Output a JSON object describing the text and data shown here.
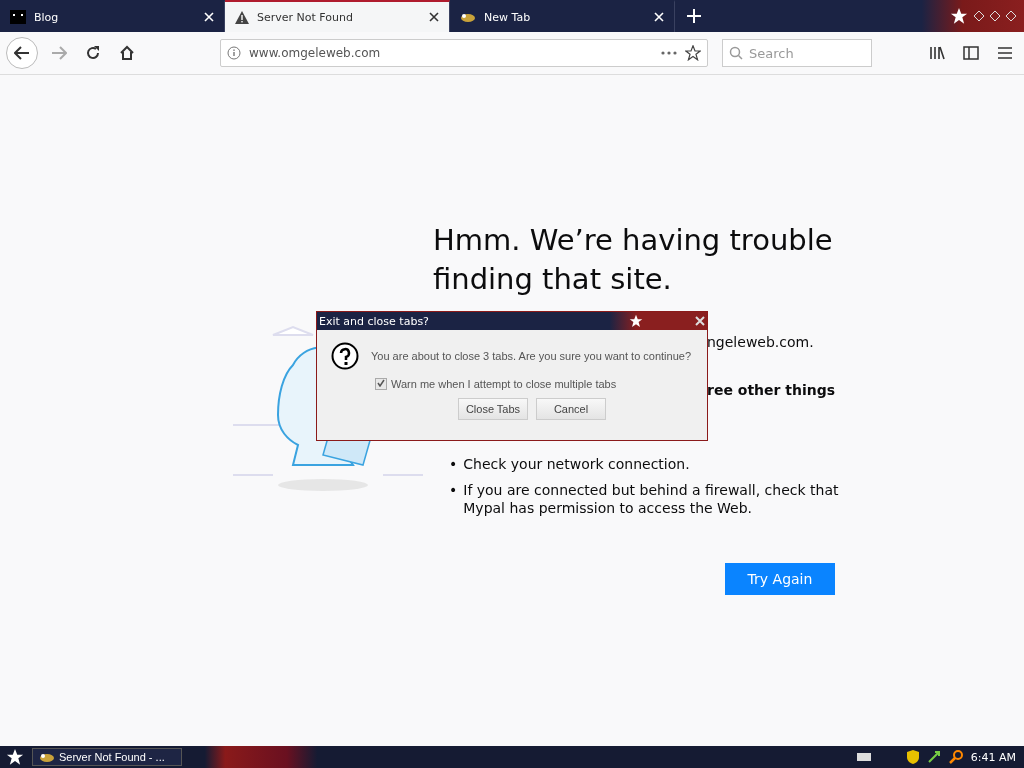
{
  "tabs": [
    {
      "label": "Blog",
      "selected": false
    },
    {
      "label": "Server Not Found",
      "selected": true
    },
    {
      "label": "New Tab",
      "selected": false
    }
  ],
  "address": {
    "value": "www.omgeleweb.com"
  },
  "search": {
    "placeholder": "Search"
  },
  "error": {
    "title": "Hmm. We’re having trouble finding that site.",
    "fragments": [
      "ngeleweb.com.",
      "ree other things"
    ],
    "bullets": [
      {
        "marker": "•",
        "text": "Check your network connection."
      },
      {
        "marker": "•",
        "text": "If you are connected but behind a firewall, check that Mypal has permission to access the Web."
      }
    ],
    "button": "Try Again"
  },
  "dialog": {
    "title": "Exit and close tabs?",
    "message": "You are about to close 3 tabs. Are you sure you want to continue?",
    "checkbox": {
      "label": "Warn me when I attempt to close multiple tabs",
      "checked": true
    },
    "buttons": [
      "Close Tabs",
      "Cancel"
    ]
  },
  "taskbar": {
    "task": "Server Not Found - ...",
    "clock": "6:41 AM"
  }
}
